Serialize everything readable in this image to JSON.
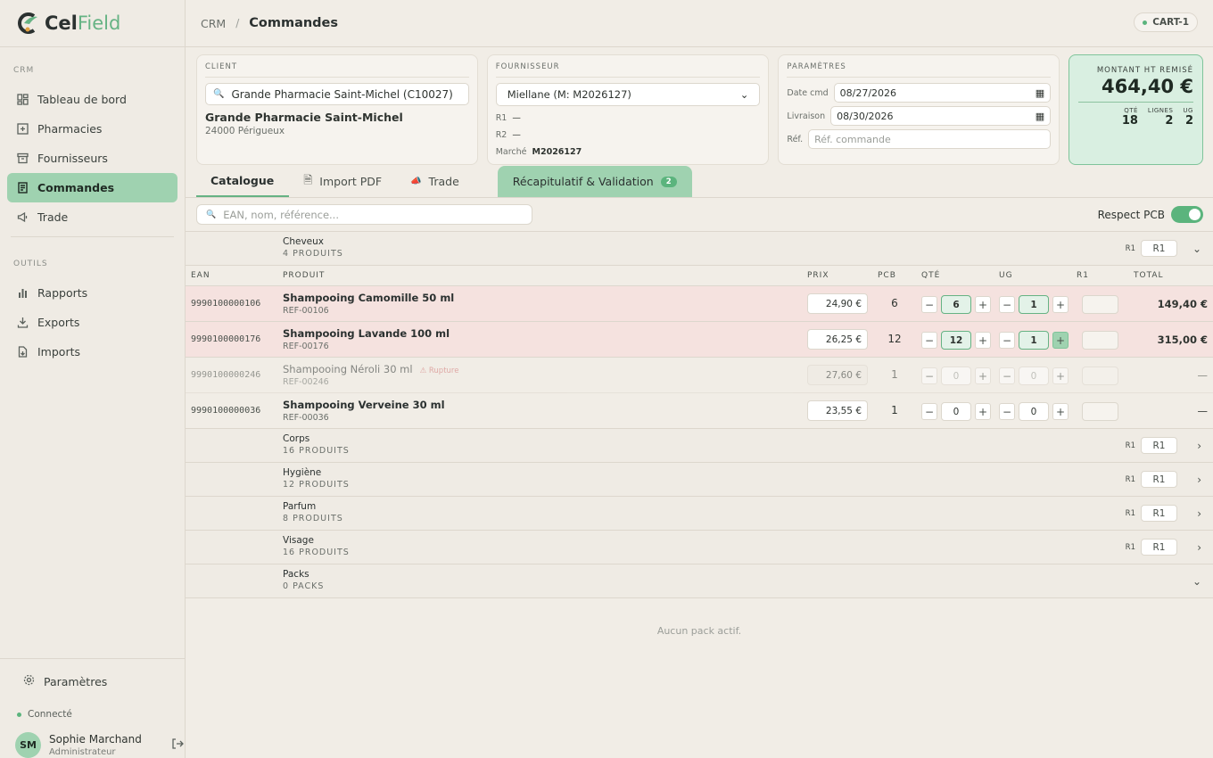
{
  "app": {
    "logo_text_1": "Cel",
    "logo_text_2": "Field"
  },
  "sidebar": {
    "section_crm": "CRM",
    "crm_items": [
      {
        "label": "Tableau de bord",
        "icon": "dashboard-icon"
      },
      {
        "label": "Pharmacies",
        "icon": "pharmacy-icon"
      },
      {
        "label": "Fournisseurs",
        "icon": "supplier-icon"
      },
      {
        "label": "Commandes",
        "icon": "orders-icon",
        "active": true
      },
      {
        "label": "Trade",
        "icon": "megaphone-icon"
      }
    ],
    "section_tools": "OUTILS",
    "tool_items": [
      {
        "label": "Rapports",
        "icon": "bar-chart-icon"
      },
      {
        "label": "Exports",
        "icon": "download-icon"
      },
      {
        "label": "Imports",
        "icon": "file-import-icon"
      }
    ],
    "settings": "Paramètres",
    "status": "Connecté",
    "user": {
      "initials": "SM",
      "name": "Sophie Marchand",
      "role": "Administrateur"
    }
  },
  "topbar": {
    "crumb_root": "CRM",
    "crumb_sep": "/",
    "crumb_current": "Commandes",
    "cart": "CART-1"
  },
  "client": {
    "header": "CLIENT",
    "search_value": "Grande Pharmacie Saint-Michel (C10027)",
    "name": "Grande Pharmacie Saint-Michel",
    "address": "24000 Périgueux"
  },
  "supplier": {
    "header": "FOURNISSEUR",
    "selected": "Miellane (M: M2026127)",
    "r1_label": "R1",
    "r1_value": "—",
    "r2_label": "R2",
    "r2_value": "—",
    "market_label": "Marché",
    "market_value": "M2026127"
  },
  "params": {
    "header": "PARAMÈTRES",
    "date_cmd_label": "Date cmd",
    "date_cmd": "08/27/2026",
    "delivery_label": "Livraison",
    "delivery": "08/30/2026",
    "ref_label": "Réf.",
    "ref_placeholder": "Réf. commande"
  },
  "totals": {
    "label": "MONTANT HT REMISÉ",
    "amount": "464,40 €",
    "qty_label": "QTÉ",
    "qty": "18",
    "lines_label": "LIGNES",
    "lines": "2",
    "ug_label": "UG",
    "ug": "2"
  },
  "tabs": {
    "catalogue": "Catalogue",
    "import_pdf": "Import PDF",
    "trade": "Trade",
    "recap": "Récapitulatif & Validation",
    "recap_badge": "2"
  },
  "search": {
    "placeholder": "EAN, nom, référence...",
    "pcb_label": "Respect PCB",
    "pcb_on": true
  },
  "table_headers": {
    "ean": "EAN",
    "product": "PRODUIT",
    "price": "PRIX",
    "pcb": "PCB",
    "qty": "QTÉ",
    "ug": "UG",
    "r1": "R1",
    "total": "TOTAL"
  },
  "groups": [
    {
      "name": "Cheveux",
      "count": "4 PRODUITS",
      "r1_label": "R1",
      "r1_value": "R1",
      "expanded": true
    },
    {
      "name": "Corps",
      "count": "16 PRODUITS",
      "r1_label": "R1",
      "r1_value": "R1"
    },
    {
      "name": "Hygiène",
      "count": "12 PRODUITS",
      "r1_label": "R1",
      "r1_value": "R1"
    },
    {
      "name": "Parfum",
      "count": "8 PRODUITS",
      "r1_label": "R1",
      "r1_value": "R1"
    },
    {
      "name": "Visage",
      "count": "16 PRODUITS",
      "r1_label": "R1",
      "r1_value": "R1"
    },
    {
      "name": "Packs",
      "count": "0 PACKS",
      "expanded": true
    }
  ],
  "products": [
    {
      "ean": "9990100000106",
      "name": "Shampooing Camomille 50 ml",
      "ref": "REF-00106",
      "price": "24,90 €",
      "pcb": "6",
      "qty": "6",
      "ug": "1",
      "total": "149,40 €"
    },
    {
      "ean": "9990100000176",
      "name": "Shampooing Lavande 100 ml",
      "ref": "REF-00176",
      "price": "26,25 €",
      "pcb": "12",
      "qty": "12",
      "ug": "1",
      "total": "315,00 €"
    },
    {
      "ean": "9990100000246",
      "name": "Shampooing Néroli 30 ml",
      "ref": "REF-00246",
      "price": "27,60 €",
      "pcb": "1",
      "qty": "0",
      "ug": "0",
      "total": "—",
      "badge": "⚠ Rupture"
    },
    {
      "ean": "9990100000036",
      "name": "Shampooing Verveine 30 ml",
      "ref": "REF-00036",
      "price": "23,55 €",
      "pcb": "1",
      "qty": "0",
      "ug": "0",
      "total": "—"
    }
  ],
  "packs_empty": "Aucun pack actif.",
  "colors": {
    "accent": "#66b384",
    "accent_light": "#9fd2b0",
    "highlight_row": "#f5e2df"
  }
}
